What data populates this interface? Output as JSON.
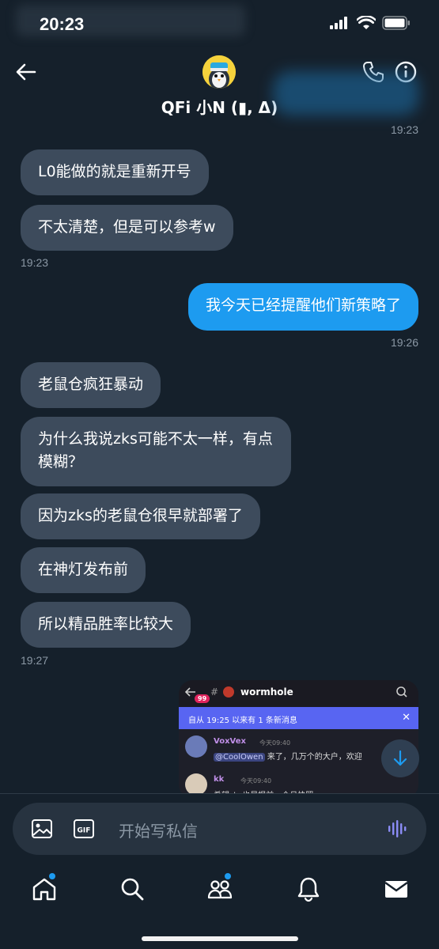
{
  "status_bar": {
    "time": "20:23"
  },
  "header": {
    "title": "QFi 小N (▮, Δ)"
  },
  "messages": [
    {
      "text": "L0能做的就是重新开号"
    },
    {
      "text": "不太清楚，但是可以参考w"
    },
    {
      "text": "我今天已经提醒他们新策略了"
    },
    {
      "text": "老鼠仓疯狂暴动"
    },
    {
      "text": "为什么我说zks可能不太一样，有点模糊？"
    },
    {
      "text": "因为zks的老鼠仓很早就部署了"
    },
    {
      "text": "在神灯发布前"
    },
    {
      "text": "所以精品胜率比较大"
    }
  ],
  "timestamps": [
    "19:23",
    "19:23",
    "19:26",
    "19:27"
  ],
  "shared_card": {
    "channel": "wormhole",
    "badge": "99",
    "banner": "自从 19:25 以来有 1 条新消息",
    "msg1_user": "VoxVex",
    "msg1_time": "今天09:40",
    "msg1_mention": "@CoolOwen",
    "msg1_text": "来了，几万个的大户，欢迎",
    "msg2_user": "kk",
    "msg2_time": "今天09:40",
    "msg2_text": "希望zks也是提前一个月快照"
  },
  "composer": {
    "placeholder": "开始写私信"
  },
  "colors": {
    "background": "#15202b",
    "incoming": "#3d4b5c",
    "outgoing": "#1d9bf0",
    "accent": "#1d9bf0"
  },
  "icons": [
    "back-arrow-icon",
    "phone-icon",
    "info-icon",
    "image-icon",
    "gif-icon",
    "voice-icon",
    "home-icon",
    "search-icon",
    "communities-icon",
    "notifications-icon",
    "messages-icon",
    "scroll-down-icon"
  ]
}
